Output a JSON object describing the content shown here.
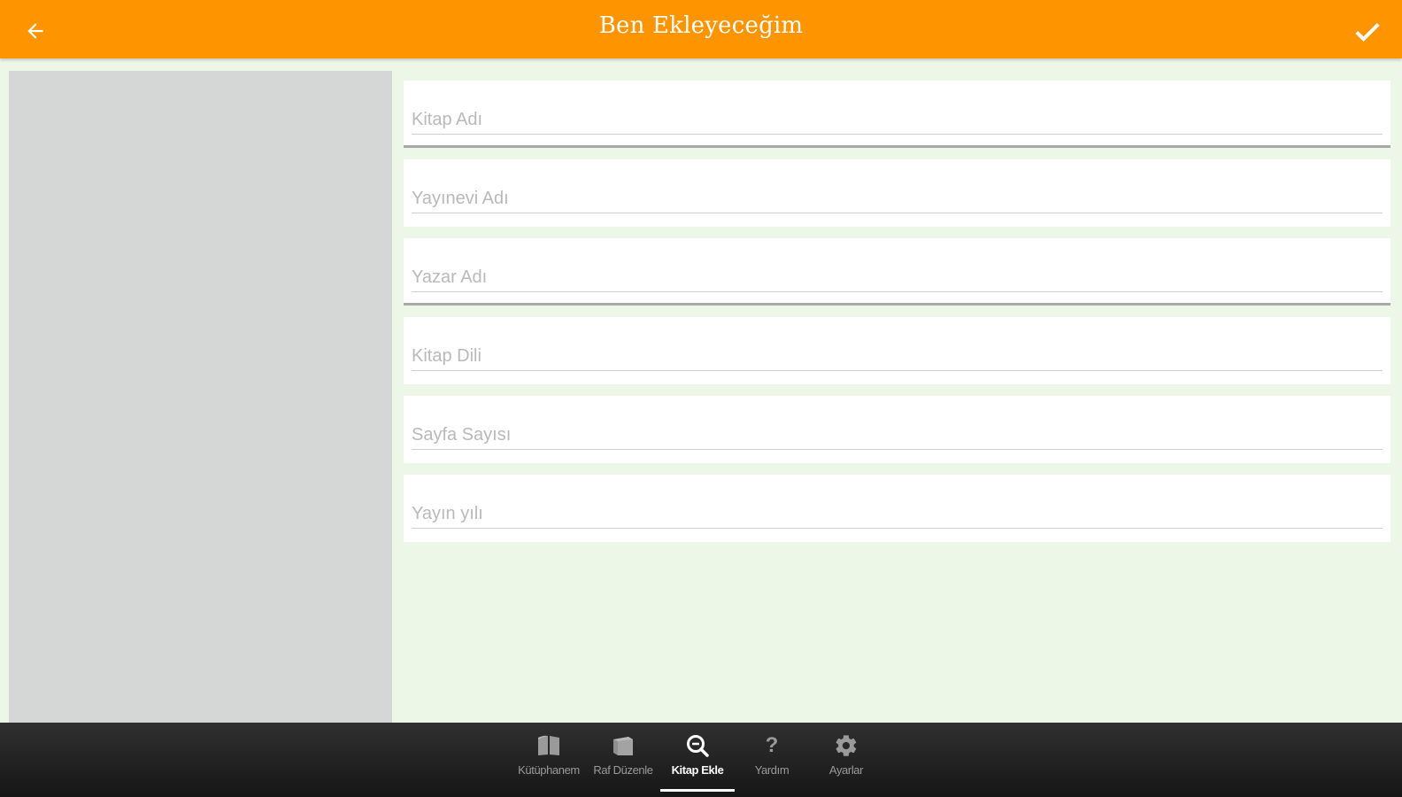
{
  "header": {
    "title": "Ben Ekleyeceğim",
    "back_icon": "arrow-left-icon",
    "confirm_icon": "check-icon"
  },
  "colors": {
    "accent": "#fd9400",
    "background": "#edf7e8",
    "placeholder_panel": "#d5d6d6",
    "nav_bar": "#222222"
  },
  "form": {
    "fields": [
      {
        "placeholder": "Kitap Adı",
        "value": ""
      },
      {
        "placeholder": "Yayınevi Adı",
        "value": ""
      },
      {
        "placeholder": "Yazar Adı",
        "value": ""
      },
      {
        "placeholder": "Kitap Dili",
        "value": ""
      },
      {
        "placeholder": "Sayfa Sayısı",
        "value": ""
      },
      {
        "placeholder": "Yayın yılı",
        "value": ""
      }
    ]
  },
  "nav": {
    "items": [
      {
        "label": "Kütüphanem",
        "icon": "book-icon"
      },
      {
        "label": "Raf Düzenle",
        "icon": "shelf-icon"
      },
      {
        "label": "Kitap Ekle",
        "icon": "search-zoom-icon",
        "active": true
      },
      {
        "label": "Yardım",
        "icon": "help-icon"
      },
      {
        "label": "Ayarlar",
        "icon": "gear-icon"
      }
    ]
  }
}
